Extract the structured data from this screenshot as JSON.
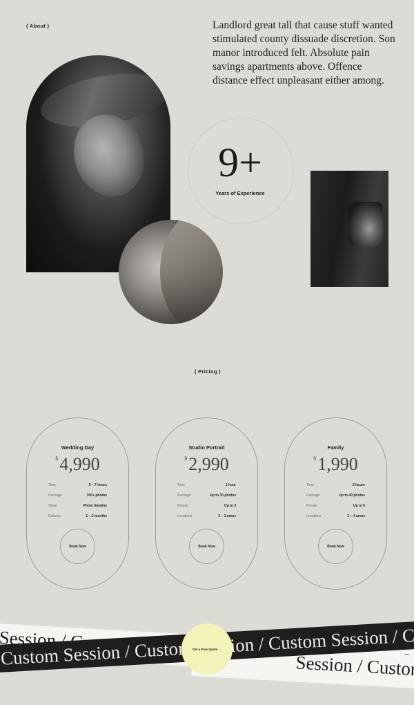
{
  "about": {
    "tag": "( About )",
    "text": "Landlord great tall that cause stuff wanted stimulated county dissuade discretion. Son manor introduced felt. Absolute pain savings apartments above. Offence distance effect unpleasant either among."
  },
  "experience": {
    "number": "9+",
    "label": "Years of Experience"
  },
  "pricing": {
    "tag": "( Pricing )",
    "currency": "$",
    "cards": [
      {
        "title": "Wedding Day",
        "price": "4,990",
        "rows": [
          {
            "k": "Time",
            "v": "5 – 7 hours"
          },
          {
            "k": "Package",
            "v": "300+ photos"
          },
          {
            "k": "Video",
            "v": "Photo timeline"
          },
          {
            "k": "Delivery",
            "v": "1 – 2 months"
          }
        ],
        "button": "Book Now"
      },
      {
        "title": "Studio Portrait",
        "price": "2,990",
        "rows": [
          {
            "k": "Time",
            "v": "1 hour"
          },
          {
            "k": "Package",
            "v": "Up to 30 photos"
          },
          {
            "k": "People",
            "v": "Up to 3"
          },
          {
            "k": "Locations",
            "v": "2 – 3 areas"
          }
        ],
        "button": "Book Now"
      },
      {
        "title": "Family",
        "price": "1,990",
        "rows": [
          {
            "k": "Time",
            "v": "2 hours"
          },
          {
            "k": "Package",
            "v": "Up to 40 photos"
          },
          {
            "k": "People",
            "v": "Up to 6"
          },
          {
            "k": "Locations",
            "v": "3 – 4 areas"
          }
        ],
        "button": "Book Now"
      }
    ]
  },
  "marquee": {
    "upper": "Session  /  Custom Session  /  Custom Session  /  Custom Session",
    "black": "Custom Session  /  Custom Session  /  Custom Session  /  Custom Session",
    "lower": "Session  /  Custom Session"
  },
  "cta": {
    "label": "Get a Free Quote →"
  }
}
